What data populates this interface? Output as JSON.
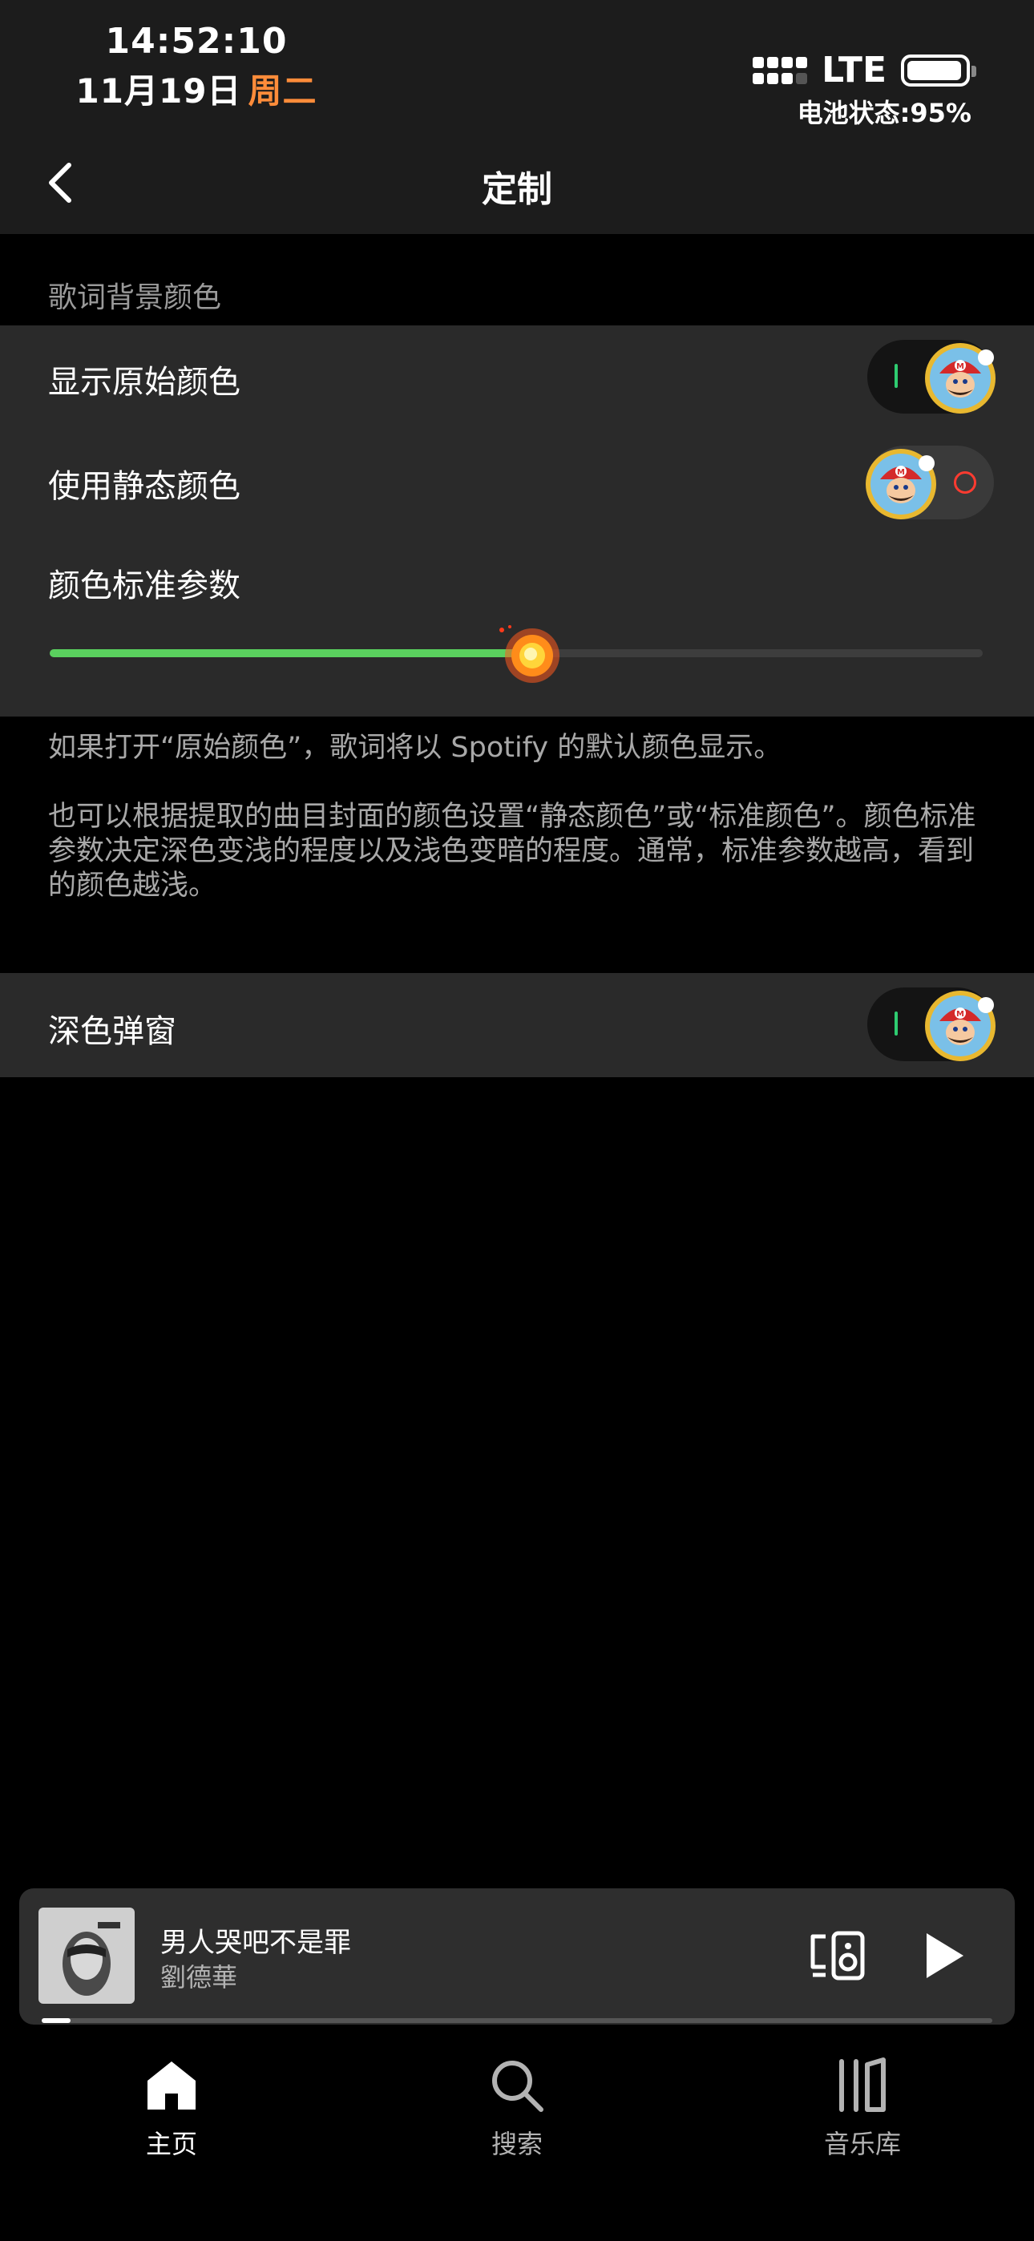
{
  "status": {
    "time": "14:52:10",
    "date": "11月19日",
    "weekday": "周二",
    "network": "LTE",
    "battery_text": "电池状态:95%",
    "battery_level": 0.95,
    "weekday_color": "#ff8c3a"
  },
  "nav": {
    "title": "定制",
    "back_icon": "chevron-left-icon"
  },
  "lyrics_bg": {
    "section_label": "歌词背景颜色",
    "show_original": {
      "label": "显示原始颜色",
      "on": true
    },
    "use_static": {
      "label": "使用静态颜色",
      "on": false
    },
    "color_param": {
      "label": "颜色标准参数",
      "value": 0.51
    }
  },
  "description": {
    "para1": "如果打开“原始颜色”，歌词将以 Spotify 的默认颜色显示。",
    "para2": "也可以根据提取的曲目封面的颜色设置“静态颜色”或“标准颜色”。颜色标准参数决定深色变浅的程度以及浅色变暗的程度。通常，标准参数越高，看到的颜色越浅。"
  },
  "dark_popup": {
    "label": "深色弹窗",
    "on": true
  },
  "player": {
    "title": "男人哭吧不是罪",
    "artist": "劉德華",
    "progress": 0.03,
    "device_icon": "connect-device-icon",
    "play_icon": "play-icon"
  },
  "tabs": [
    {
      "label": "主页",
      "icon": "home-icon",
      "active": true
    },
    {
      "label": "搜索",
      "icon": "search-icon",
      "active": false
    },
    {
      "label": "音乐库",
      "icon": "library-icon",
      "active": false
    }
  ],
  "colors": {
    "accent_green": "#5ad05e",
    "background": "#000000",
    "group_bg": "#2a2a2a"
  }
}
